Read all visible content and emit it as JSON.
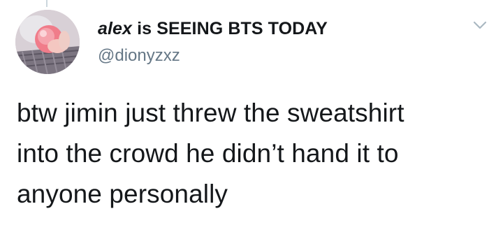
{
  "tweet": {
    "display_name_prefix": "alex",
    "display_name_rest": " is SEEING BTS TODAY",
    "handle": "@dionyzxz",
    "text_lines": [
      "btw jimin just threw the sweatshirt",
      "into the crowd he didn’t hand it to",
      "anyone personally"
    ],
    "menu_icon": "chevron-down-icon",
    "avatar_icon": "avatar"
  },
  "colors": {
    "text": "#14171a",
    "secondary": "#657786",
    "chevron": "#aab8c2",
    "thread_line": "#ccd6dd"
  }
}
